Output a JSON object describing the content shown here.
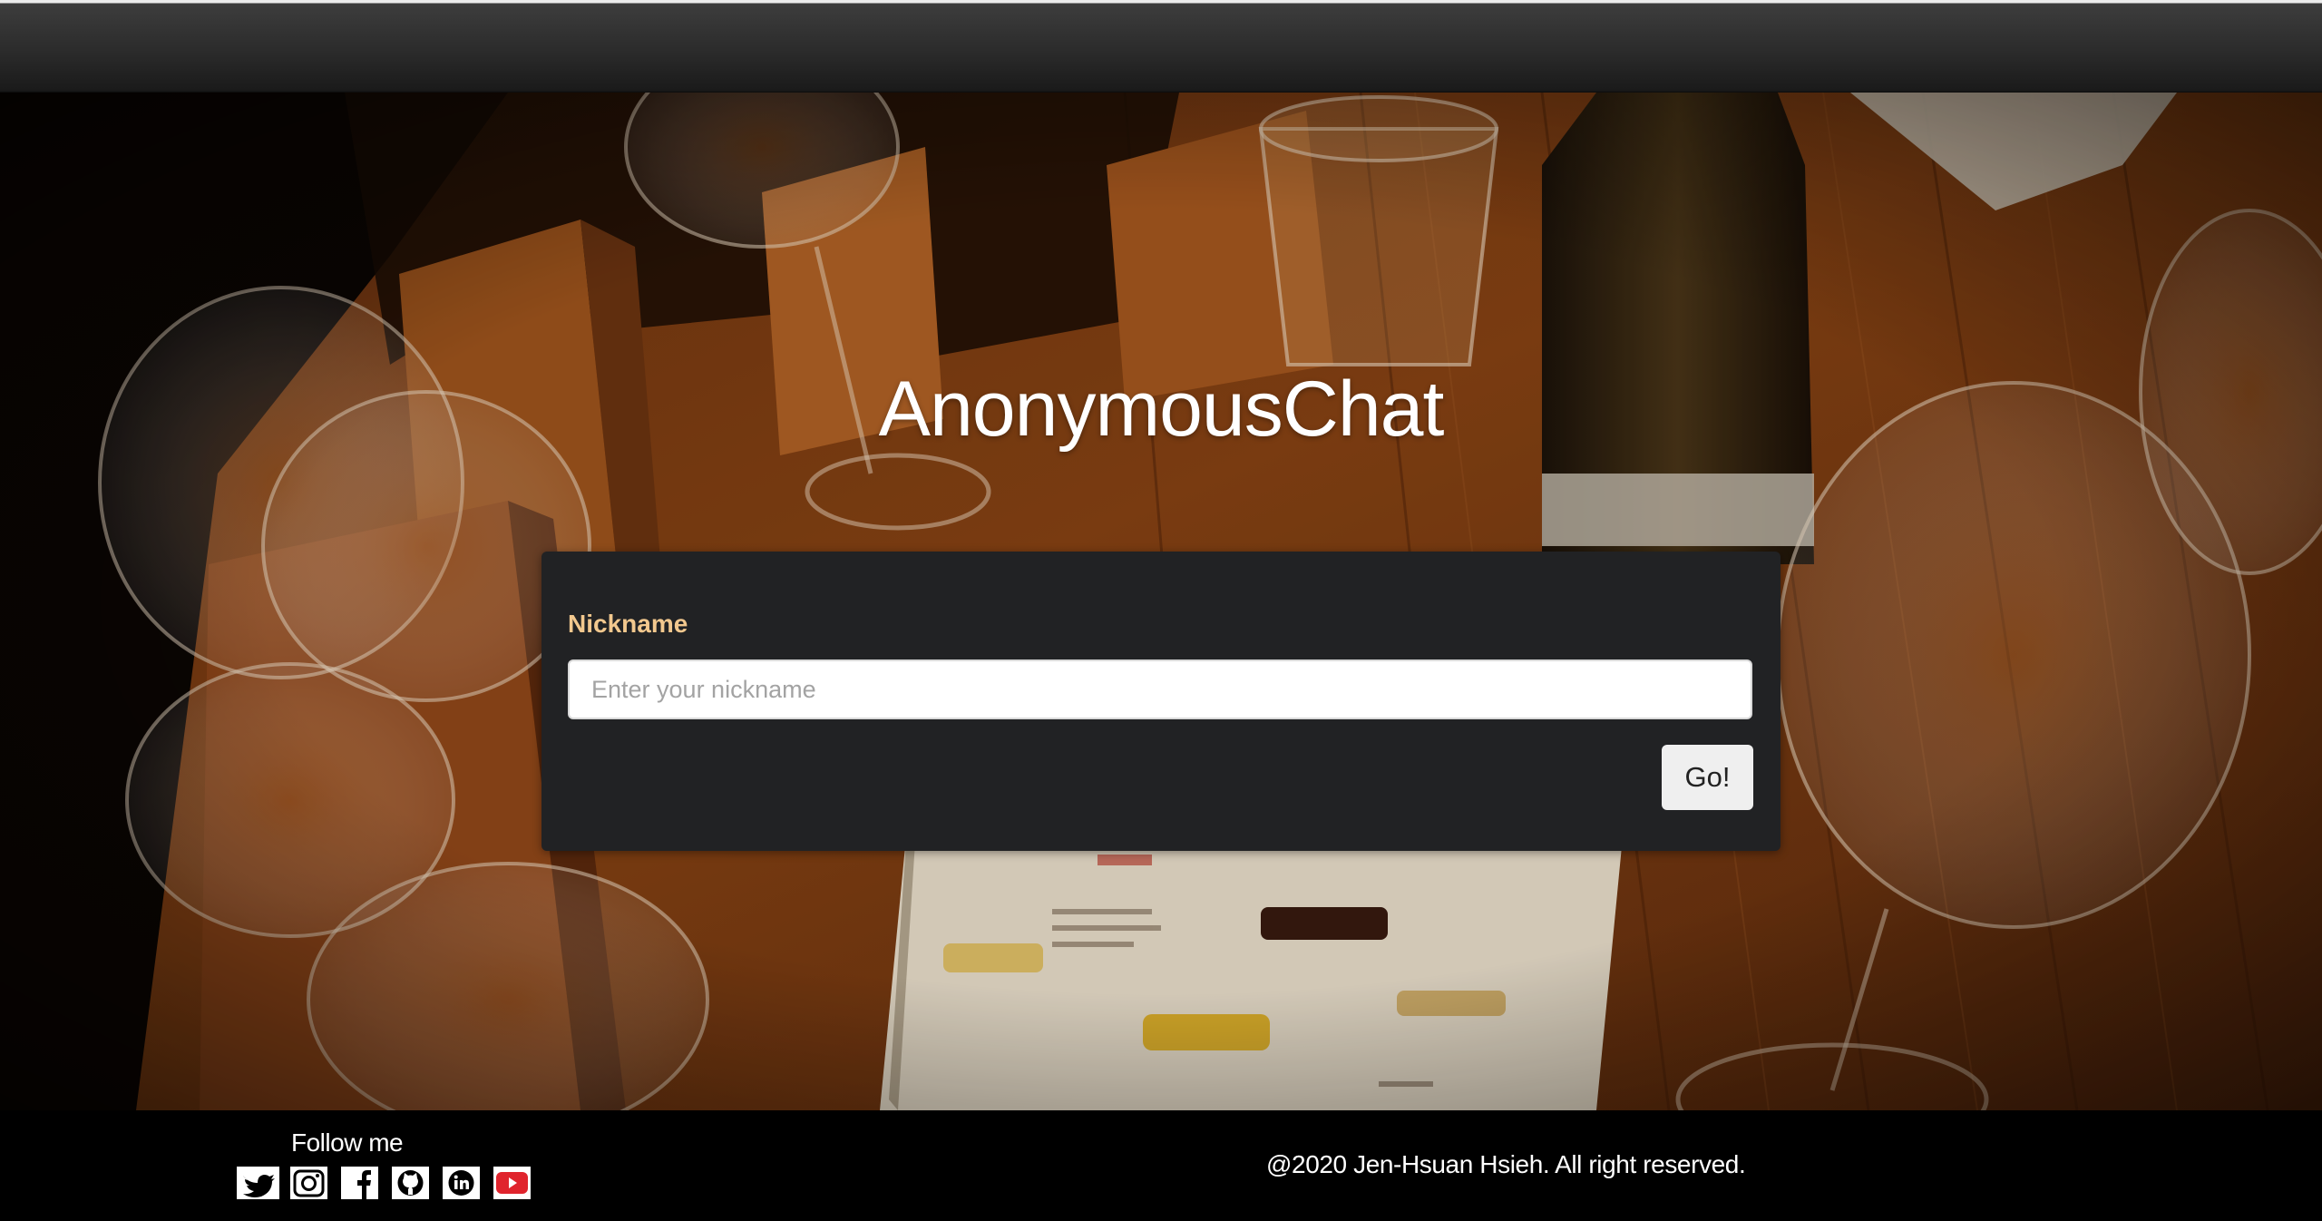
{
  "app": {
    "title": "AnonymousChat"
  },
  "form": {
    "label": "Nickname",
    "input_value": "",
    "input_placeholder": "Enter your nickname",
    "submit_label": "Go!"
  },
  "footer": {
    "follow_label": "Follow me",
    "social_icons": [
      "twitter-icon",
      "instagram-icon",
      "facebook-icon",
      "github-icon",
      "linkedin-icon",
      "youtube-icon"
    ],
    "copyright": "@2020 Jen-Hsuan Hsieh. All right reserved."
  },
  "colors": {
    "navbar": "#2b2b2b",
    "card_background": "#212224",
    "label_accent": "#f2c88e",
    "button_background": "#efefef",
    "footer_background": "#000000",
    "youtube_red": "#e0242d"
  }
}
